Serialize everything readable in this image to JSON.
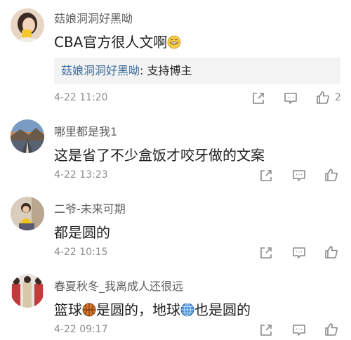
{
  "comments": [
    {
      "username": "菇娘洞洞好黑呦",
      "text": "CBA官方很人文啊",
      "emoji": "grinning-face-icon",
      "reply": {
        "name": "菇娘洞洞好黑呦",
        "sep": ": ",
        "text": "支持博主"
      },
      "time": "4-22 11:20",
      "likes": "2"
    },
    {
      "username": "哪里都是我1",
      "text": "这是省了不少盒饭才咬牙做的文案",
      "time": "4-22 13:23"
    },
    {
      "username": "二爷-未来可期",
      "text": "都是圆的",
      "time": "4-22 10:15"
    },
    {
      "username": "春夏秋冬_我离成人还很远",
      "text_part1": "篮球",
      "emoji1": "basketball-icon",
      "text_part2": "是圆的，地球",
      "emoji2": "globe-icon",
      "text_part3": "也是圆的",
      "time": "4-22 09:17"
    }
  ],
  "icons": {
    "share": "share-icon",
    "comment": "comment-icon",
    "like": "thumbs-up-icon"
  },
  "colors": {
    "username": "#5e5e5e",
    "reply_name": "#3d6b9b",
    "time": "#8d8d8d",
    "icon": "#8a8a8a"
  }
}
